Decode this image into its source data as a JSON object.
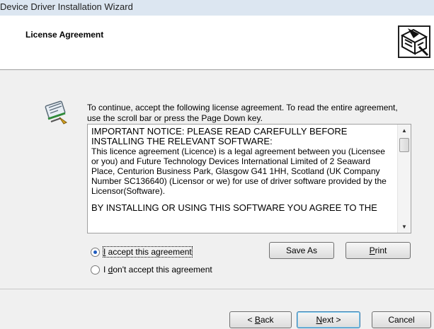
{
  "window": {
    "title": "Device Driver Installation Wizard"
  },
  "header": {
    "title": "License Agreement",
    "logo_icon": "installer-logo-icon"
  },
  "instructions": {
    "icon": "license-scroll-icon",
    "text": "To continue, accept the following license agreement. To read the entire agreement, use the scroll bar or press the Page Down key."
  },
  "license": {
    "heading": "IMPORTANT NOTICE: PLEASE READ CAREFULLY BEFORE INSTALLING THE RELEVANT SOFTWARE:",
    "body": "This licence agreement (Licence) is a legal agreement between you (Licensee or you) and Future Technology Devices International Limited of 2 Seaward Place, Centurion Business Park, Glasgow G41 1HH, Scotland (UK Company Number SC136640) (Licensor or we) for use of driver software provided by the Licensor(Software).",
    "cont": "BY INSTALLING OR USING THIS SOFTWARE YOU AGREE TO THE"
  },
  "options": {
    "accept": {
      "pre": "",
      "acc": "I",
      "post": " accept this agreement",
      "checked": true
    },
    "decline": {
      "pre": "I ",
      "acc": "d",
      "post": "on't accept this agreement",
      "checked": false
    }
  },
  "buttons": {
    "save_as": "Save As",
    "print": {
      "acc": "P",
      "post": "rint"
    },
    "back": {
      "pre": "< ",
      "acc": "B",
      "post": "ack"
    },
    "next": {
      "acc": "N",
      "post": "ext >"
    },
    "cancel": "Cancel"
  }
}
